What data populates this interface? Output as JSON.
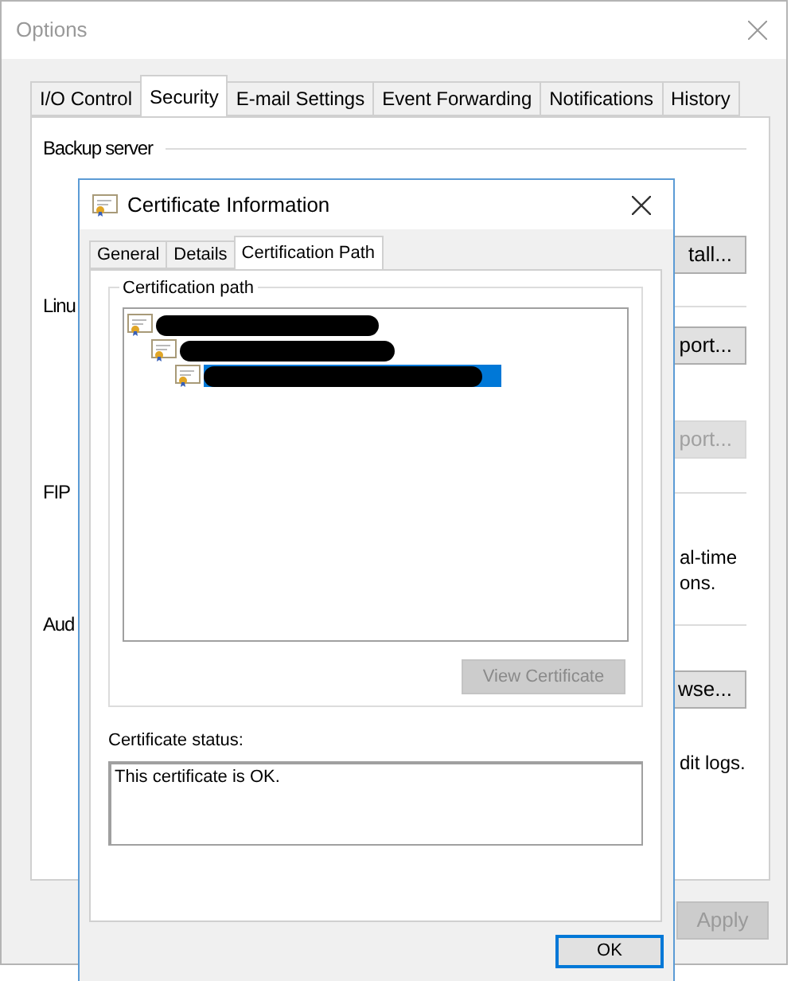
{
  "window": {
    "title": "Options"
  },
  "tabs": [
    {
      "label": "I/O Control",
      "selected": false
    },
    {
      "label": "Security",
      "selected": true
    },
    {
      "label": "E-mail Settings",
      "selected": false
    },
    {
      "label": "Event Forwarding",
      "selected": false
    },
    {
      "label": "Notifications",
      "selected": false
    },
    {
      "label": "History",
      "selected": false
    }
  ],
  "panel_rows": [
    {
      "kind": "heading",
      "text": "Backup server"
    },
    {
      "kind": "button",
      "label": "tall...",
      "disabled": false
    },
    {
      "kind": "heading",
      "text": "Linu"
    },
    {
      "kind": "button",
      "label": "port...",
      "disabled": false
    },
    {
      "kind": "button",
      "label": "port...",
      "disabled": true
    },
    {
      "kind": "heading",
      "text": "FIP"
    },
    {
      "kind": "text",
      "lines": [
        "al-time",
        "ons."
      ]
    },
    {
      "kind": "heading",
      "text": "Aud"
    },
    {
      "kind": "button",
      "label": "wse...",
      "disabled": false
    },
    {
      "kind": "text",
      "lines": [
        "dit logs."
      ]
    }
  ],
  "apply_button": {
    "label": "Apply",
    "disabled": true
  },
  "dialog": {
    "title": "Certificate Information",
    "tabs": [
      {
        "label": "General",
        "selected": false
      },
      {
        "label": "Details",
        "selected": false
      },
      {
        "label": "Certification Path",
        "selected": true
      }
    ],
    "group_label": "Certification path",
    "tree": [
      {
        "selected": false,
        "children": [
          {
            "selected": false,
            "children": [
              {
                "selected": true
              }
            ]
          }
        ]
      }
    ],
    "view_button": {
      "label": "View Certificate",
      "disabled": true
    },
    "status_label": "Certificate status:",
    "status_value": "This certificate is OK.",
    "ok_button": {
      "label": "OK"
    }
  }
}
